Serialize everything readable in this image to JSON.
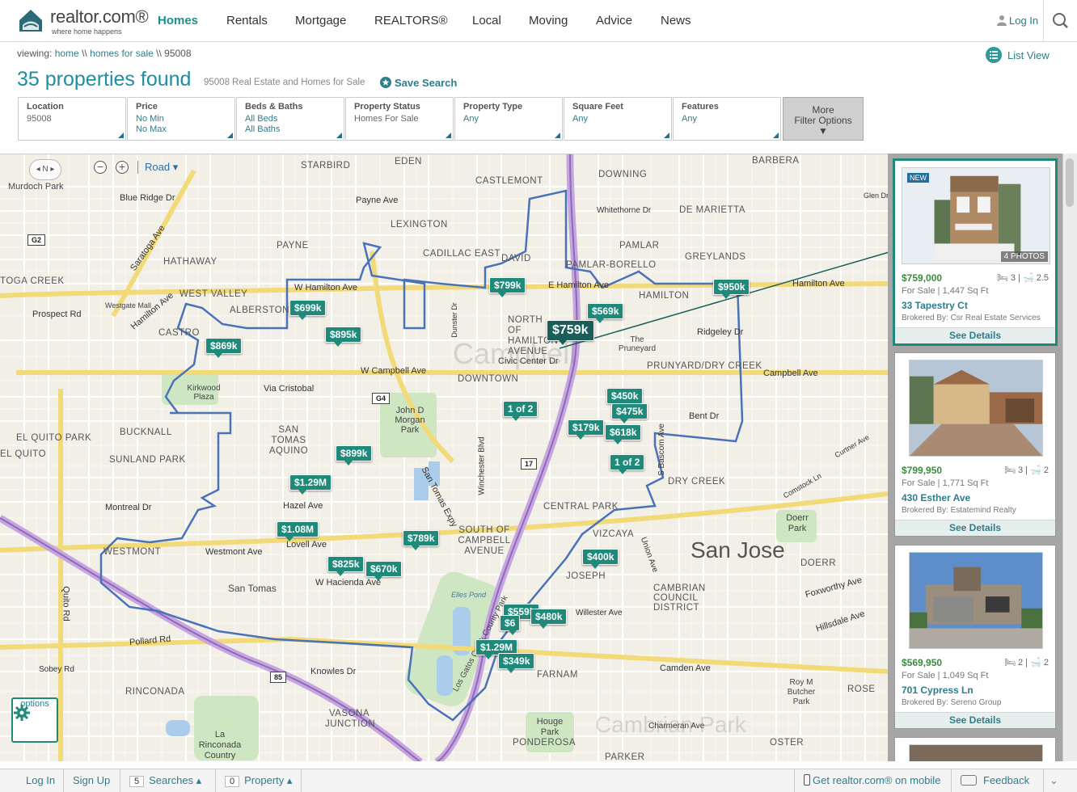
{
  "header": {
    "logo_text": "realtor.com®",
    "logo_tagline": "where home happens",
    "nav": [
      "Homes",
      "Rentals",
      "Mortgage",
      "REALTORS®",
      "Local",
      "Moving",
      "Advice",
      "News"
    ],
    "login": "Log In"
  },
  "breadcrumb": {
    "viewing": "viewing:",
    "home": "home",
    "sep": "\\\\",
    "homes_for_sale": "homes for sale",
    "zip": "95008"
  },
  "results": {
    "title": "35 properties found",
    "subtitle": "95008 Real Estate and Homes for Sale",
    "save_search": "Save Search",
    "list_view": "List View"
  },
  "filters": [
    {
      "label": "Location",
      "v1": "95008",
      "v2": ""
    },
    {
      "label": "Price",
      "v1": "No Min",
      "v2": "No Max"
    },
    {
      "label": "Beds & Baths",
      "v1": "All Beds",
      "v2": "All Baths"
    },
    {
      "label": "Property Status",
      "v1": "Homes For Sale",
      "v2": ""
    },
    {
      "label": "Property Type",
      "v1": "Any",
      "v2": ""
    },
    {
      "label": "Square Feet",
      "v1": "Any",
      "v2": ""
    },
    {
      "label": "Features",
      "v1": "Any",
      "v2": ""
    }
  ],
  "more_filters": {
    "line1": "More",
    "line2": "Filter Options",
    "arrow": "▼"
  },
  "map": {
    "compass": "◂ N ▸",
    "road_label": "Road ▾",
    "options_label": "options",
    "places": [
      "Murdoch Park",
      "Blue Ridge Dr",
      "Saratoga Ave",
      "Hathaway",
      "Toga Creek",
      "Prospect Rd",
      "Westgate Mall",
      "Hamilton Ave",
      "West Valley",
      "Castro",
      "Alberstone",
      "Payne",
      "Payne Ave",
      "Starbird",
      "Eden",
      "Lexington",
      "Cadillac East",
      "David",
      "Castlemont",
      "Downing",
      "Whitethorne Dr",
      "De Marietta",
      "Barbera",
      "Pamlar",
      "Pamlar-Borello",
      "Greylands",
      "Hamilton",
      "W Hamilton Ave",
      "E Hamilton Ave",
      "Hamilton Ave",
      "North of Hamilton Avenue",
      "The Pruneyard",
      "Ridgeley Dr",
      "Prunyard/Dry Creek",
      "Civic Center Dr",
      "Downtown",
      "W Campbell Ave",
      "Campbell Ave",
      "Via Cristobal",
      "Kirkwood Plaza",
      "Bucknall",
      "El Quito Park",
      "El Quito",
      "Sunland Park",
      "San Tomas Aquino",
      "John D Morgan Park",
      "Bent Dr",
      "Dry Creek",
      "Central Park",
      "Vizcaya",
      "Montreal Dr",
      "Westmont",
      "Westmont Ave",
      "Hazel Ave",
      "Lovell Ave",
      "San Tomas",
      "W Hacienda Ave",
      "South of Campbell Avenue",
      "Elles Pond",
      "Joseph",
      "Willester Ave",
      "Cambrian Council District",
      "Foxworthy Ave",
      "Hillsdale Ave",
      "Pollard Rd",
      "Sobey Rd",
      "Knowles Dr",
      "Farnam",
      "Camden Ave",
      "Roy M Butcher Park",
      "Rose",
      "Rinconada",
      "Vasona Junction",
      "La Rinconada Country Club",
      "Houge Park",
      "Ponderosa",
      "Parker",
      "Charmeran Ave",
      "Oster",
      "Doerr",
      "Doerr Park",
      "Curtner Ave",
      "Comstock Ln",
      "Glen Dr",
      "Quito Rd",
      "San Tomas Expy",
      "Los Gatos Creek County Park",
      "Dunster Dr",
      "Winchester Blvd",
      "S Bascom Ave",
      "Union Ave"
    ],
    "city": "San Jose",
    "ghost_label": "Campbell",
    "ghost_label2": "Cambrian Park",
    "shields": [
      "G2",
      "G4",
      "17",
      "85"
    ],
    "pins": [
      {
        "label": "$799k"
      },
      {
        "label": "$699k"
      },
      {
        "label": "$895k"
      },
      {
        "label": "$869k"
      },
      {
        "label": "$569k"
      },
      {
        "label": "$950k"
      },
      {
        "label": "$759k",
        "selected": true
      },
      {
        "label": "$450k"
      },
      {
        "label": "$475k"
      },
      {
        "label": "1 of 2"
      },
      {
        "label": "$179k"
      },
      {
        "label": "$618k"
      },
      {
        "label": "$899k"
      },
      {
        "label": "$1.29M"
      },
      {
        "label": "1 of 2"
      },
      {
        "label": "$1.08M"
      },
      {
        "label": "$789k"
      },
      {
        "label": "$825k"
      },
      {
        "label": "$670k"
      },
      {
        "label": "$400k"
      },
      {
        "label": "$559k"
      },
      {
        "label": "$6"
      },
      {
        "label": "$480k"
      },
      {
        "label": "$1.29M"
      },
      {
        "label": "$349k"
      }
    ]
  },
  "cards": [
    {
      "new": "NEW",
      "photos": "4 PHOTOS",
      "price": "$759,000",
      "beds": "3",
      "baths": "2.5",
      "status": "For Sale",
      "sqft": "1,447 Sq Ft",
      "address": "33 Tapestry Ct",
      "broker": "Brokered By: Csr Real Estate Services",
      "details": "See Details"
    },
    {
      "new": "",
      "photos": "",
      "price": "$799,950",
      "beds": "3",
      "baths": "2",
      "status": "For Sale",
      "sqft": "1,771 Sq Ft",
      "address": "430 Esther Ave",
      "broker": "Brokered By: Estatemind Realty",
      "details": "See Details"
    },
    {
      "new": "",
      "photos": "",
      "price": "$569,950",
      "beds": "2",
      "baths": "2",
      "status": "For Sale",
      "sqft": "1,049 Sq Ft",
      "address": "701 Cypress Ln",
      "broker": "Brokered By: Sereno Group",
      "details": "See Details"
    }
  ],
  "footer": {
    "login": "Log In",
    "signup": "Sign Up",
    "searches_count": "5",
    "searches": "Searches ▴",
    "property_count": "0",
    "property": "Property ▴",
    "mobile": "Get realtor.com® on mobile",
    "feedback": "Feedback"
  },
  "colors": {
    "brand": "#1e8ea0",
    "pin": "#1f8a7a",
    "boundary": "#4a72b8",
    "freeway": "#b18ad0",
    "arterial": "#f2dc7a"
  }
}
